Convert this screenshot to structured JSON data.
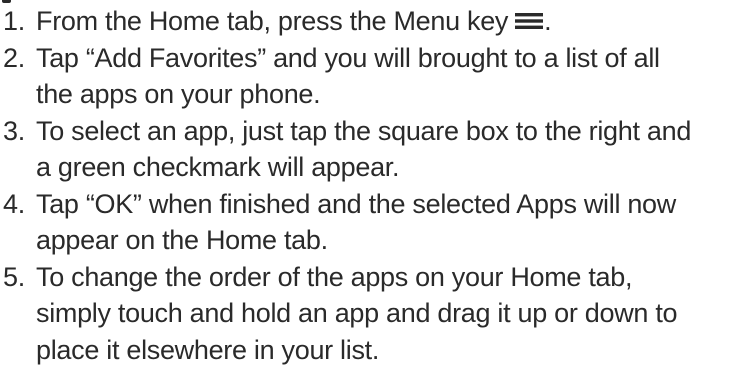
{
  "steps": [
    {
      "number": "1.",
      "text_before_icon": "From the Home tab, press the Menu key",
      "icon": "menu-icon",
      "text_after_icon": "."
    },
    {
      "number": "2.",
      "lines": [
        "Tap “Add Favorites” and you will brought to a list of all",
        "the apps on your phone."
      ]
    },
    {
      "number": "3.",
      "lines": [
        "To select an app, just tap the square box to the right and",
        "a green checkmark will appear."
      ]
    },
    {
      "number": "4.",
      "lines": [
        "Tap “OK” when finished and the selected Apps will now",
        "appear on the Home tab."
      ]
    },
    {
      "number": "5.",
      "lines": [
        "To change the order of the apps on your Home tab,",
        "simply touch and hold an app and drag it up or down to",
        "place it elsewhere in your list."
      ]
    }
  ],
  "colors": {
    "text": "#2a2a2a",
    "background": "#ffffff"
  }
}
